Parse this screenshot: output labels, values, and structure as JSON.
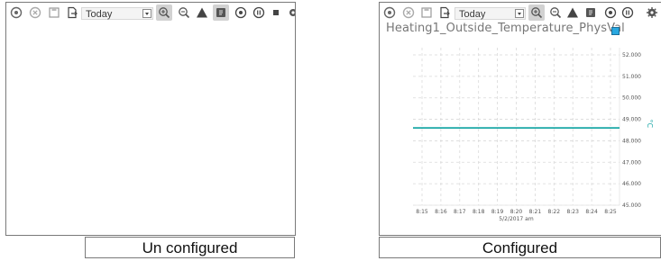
{
  "left_panel": {
    "toolbar": {
      "time_range": "Today"
    },
    "caption": "Un configured"
  },
  "right_panel": {
    "toolbar": {
      "time_range": "Today"
    },
    "caption": "Configured",
    "chart_title": "Heating1_Outside_Temperature_PhysVal"
  },
  "colors": {
    "series": "#1aa7a6",
    "grid": "#d9d9d9",
    "active_button": "#d2d2d2"
  },
  "icons": [
    "add-circle-icon",
    "remove-circle-icon",
    "save-icon",
    "export-icon",
    "zoom-in-icon",
    "zoom-out-icon",
    "alarm-triangle-icon",
    "info-square-icon",
    "play-icon",
    "pause-icon",
    "stop-icon",
    "settings-gear-icon"
  ],
  "chart_data": {
    "type": "line",
    "title": "Heating1_Outside_Temperature_PhysVal",
    "x": [
      "8:15",
      "8:16",
      "8:17",
      "8:18",
      "8:19",
      "8:20",
      "8:21",
      "8:22",
      "8:23",
      "8:24",
      "8:25"
    ],
    "x_sublabel": "5/2/2017 am",
    "y_ticks": [
      "52.000",
      "51.000",
      "50.000",
      "49.000",
      "48.000",
      "47.000",
      "46.000",
      "45.000"
    ],
    "ylabel": "°C",
    "ylim": [
      45,
      52
    ],
    "series": [
      {
        "values": [
          48.6,
          48.6,
          48.6,
          48.6,
          48.6,
          48.6,
          48.6,
          48.6,
          48.6,
          48.6,
          48.6
        ]
      }
    ],
    "grid": true,
    "y_axis_side": "right"
  }
}
